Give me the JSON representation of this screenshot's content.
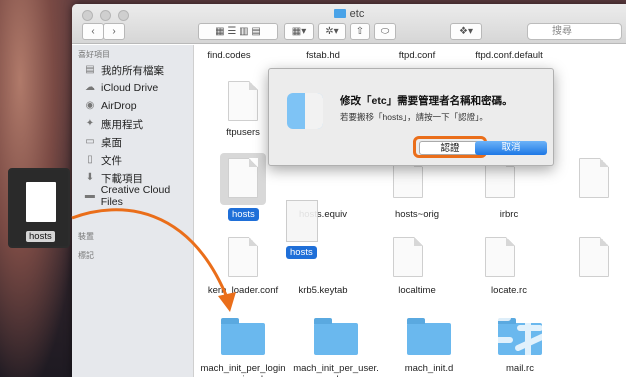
{
  "window": {
    "title": "etc"
  },
  "toolbar": {
    "search_placeholder": "搜尋"
  },
  "sidebar": {
    "favorites_label": "喜好項目",
    "items": [
      {
        "label": "我的所有檔案",
        "icon": "all-files-icon"
      },
      {
        "label": "iCloud Drive",
        "icon": "cloud-icon"
      },
      {
        "label": "AirDrop",
        "icon": "airdrop-icon"
      },
      {
        "label": "應用程式",
        "icon": "apps-icon"
      },
      {
        "label": "桌面",
        "icon": "desktop-icon"
      },
      {
        "label": "文件",
        "icon": "documents-icon"
      },
      {
        "label": "下載項目",
        "icon": "downloads-icon"
      },
      {
        "label": "Creative Cloud Files",
        "icon": "folder-icon"
      }
    ],
    "devices_label": "裝置",
    "tags_label": "標記"
  },
  "files": {
    "row0": [
      "find.codes",
      "fstab.hd",
      "ftpd.conf",
      "ftpd.conf.default"
    ],
    "row1_first": "ftpusers",
    "row2": [
      "hosts",
      "hosts.equiv",
      "hosts~orig",
      "irbrc"
    ],
    "row3": [
      "kern_loader.conf",
      "krb5.keytab",
      "localtime",
      "locate.rc"
    ],
    "row4": [
      "mach_init_per_login\nsession.d",
      "mach_init_per_user.\nd",
      "mach_init.d",
      "mail.rc"
    ],
    "selected": "hosts"
  },
  "dialog": {
    "title": "修改「etc」需要管理者名稱和密碼。",
    "message": "若要搬移「hosts」，請按一下「認證」。",
    "ok_label": "認證",
    "cancel_label": "取消"
  },
  "drag": {
    "label": "hosts",
    "ghost_label": "hosts"
  },
  "accent": "#ea6e1a"
}
